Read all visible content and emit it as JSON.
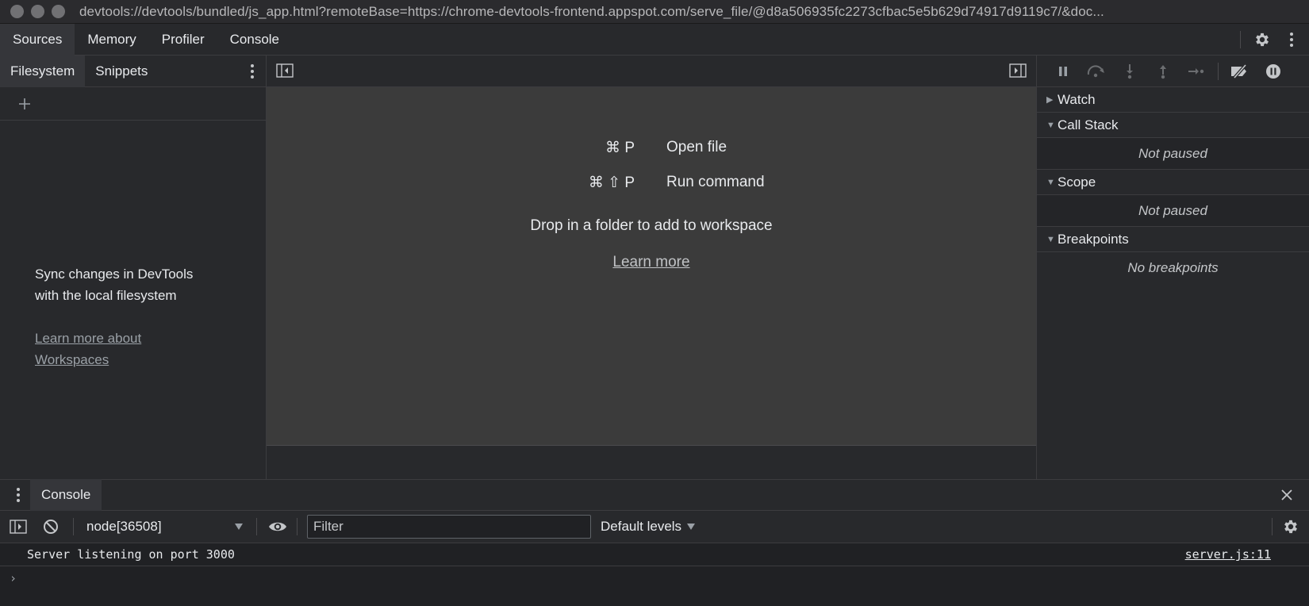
{
  "window": {
    "url": "devtools://devtools/bundled/js_app.html?remoteBase=https://chrome-devtools-frontend.appspot.com/serve_file/@d8a506935fc2273cfbac5e5b629d74917d9119c7/&doc..."
  },
  "main_tabs": [
    {
      "label": "Sources",
      "active": true
    },
    {
      "label": "Memory",
      "active": false
    },
    {
      "label": "Profiler",
      "active": false
    },
    {
      "label": "Console",
      "active": false
    }
  ],
  "navigator": {
    "tabs": [
      {
        "label": "Filesystem",
        "active": true
      },
      {
        "label": "Snippets",
        "active": false
      }
    ],
    "message_line1": "Sync changes in DevTools",
    "message_line2": "with the local filesystem",
    "link_line1": "Learn more about",
    "link_line2": "Workspaces"
  },
  "editor": {
    "shortcuts": [
      {
        "keys": "⌘ P",
        "action": "Open file"
      },
      {
        "keys": "⌘ ⇧ P",
        "action": "Run command"
      }
    ],
    "drop_text": "Drop in a folder to add to workspace",
    "learn_more": "Learn more"
  },
  "debugger": {
    "panes": [
      {
        "title": "Watch",
        "expanded": false,
        "body": ""
      },
      {
        "title": "Call Stack",
        "expanded": true,
        "body": "Not paused"
      },
      {
        "title": "Scope",
        "expanded": true,
        "body": "Not paused"
      },
      {
        "title": "Breakpoints",
        "expanded": true,
        "body": "No breakpoints"
      }
    ]
  },
  "drawer": {
    "tab": "Console",
    "context": "node[36508]",
    "filter_placeholder": "Filter",
    "levels": "Default levels",
    "messages": [
      {
        "text": "Server listening on port 3000",
        "source": "server.js:11"
      }
    ],
    "prompt": "›"
  },
  "colors": {
    "background": "#202124",
    "panel": "#28292c",
    "editor": "#3b3b3b",
    "text": "#e8eaed",
    "muted": "#9aa0a6"
  }
}
